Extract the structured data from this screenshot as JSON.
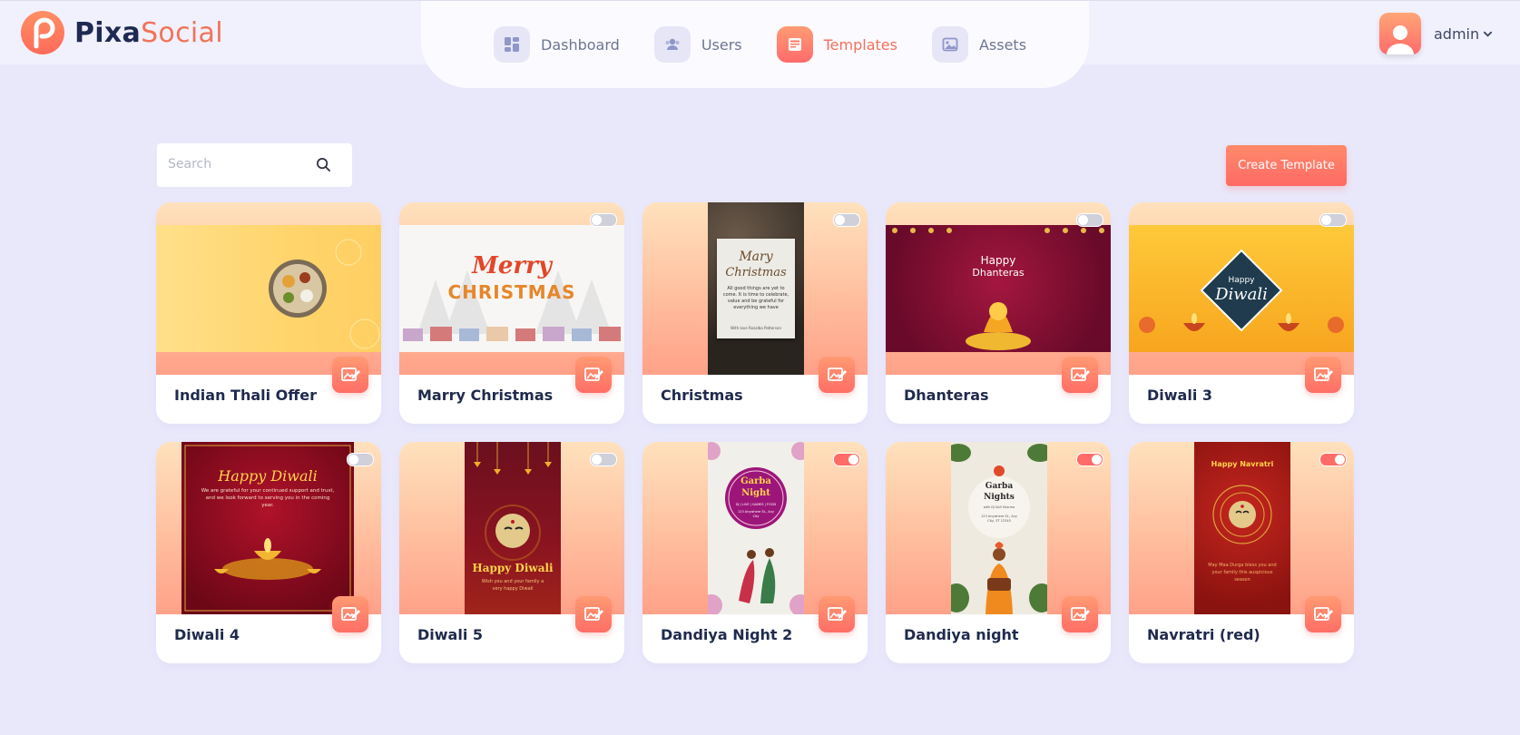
{
  "brand": {
    "part1": "Pixa",
    "part2": "Social"
  },
  "nav": [
    {
      "label": "Dashboard",
      "icon": "dashboard-icon"
    },
    {
      "label": "Users",
      "icon": "users-icon"
    },
    {
      "label": "Templates",
      "icon": "templates-icon",
      "active": true
    },
    {
      "label": "Assets",
      "icon": "assets-icon"
    }
  ],
  "user": {
    "name": "admin"
  },
  "search": {
    "placeholder": "Search"
  },
  "create_button": "Create Template",
  "colors": {
    "accent": "#ff6b6b",
    "accent_light": "#ff9b73",
    "background": "#e9e8fb",
    "title": "#1f2a4d"
  },
  "templates": [
    {
      "title": "Indian Thali Offer",
      "enabled": false,
      "art": {}
    },
    {
      "title": "Marry Christmas",
      "enabled": false,
      "art": {
        "line1": "Merry",
        "line2": "CHRISTMAS"
      }
    },
    {
      "title": "Christmas",
      "enabled": false,
      "art": {
        "line1": "Mary",
        "line2": "Christmas",
        "body": "All good things are yet to come. It is time to celebrate, value and be grateful for everything we have",
        "sign": "With love Rosalba Patterson"
      }
    },
    {
      "title": "Dhanteras",
      "enabled": false,
      "art": {
        "line1": "Happy",
        "line2": "Dhanteras"
      }
    },
    {
      "title": "Diwali 3",
      "enabled": false,
      "art": {
        "line1": "Happy",
        "line2": "Diwali"
      }
    },
    {
      "title": "Diwali 4",
      "enabled": false,
      "art": {
        "line1": "Happy Diwali",
        "body": "We are grateful for your continued support and trust, and we look forward to serving you in the coming year."
      }
    },
    {
      "title": "Diwali 5",
      "enabled": false,
      "art": {
        "line1": "Happy Diwali",
        "body": "Wish you and your family a very happy Diwali"
      }
    },
    {
      "title": "Dandiya Night 2",
      "enabled": true,
      "art": {
        "line1": "Garba",
        "line2": "Night",
        "body": "DJ | LIVE | GAMES | FOOD",
        "sub": "123 Anywhere St., Any City"
      }
    },
    {
      "title": "Dandiya night",
      "enabled": true,
      "art": {
        "line1": "Garba",
        "line2": "Nights",
        "body": "with DJ Sofi Sharma",
        "sub": "123 Anywhere St., Any City, ST 12345"
      }
    },
    {
      "title": "Navratri (red)",
      "enabled": true,
      "art": {
        "line1": "Happy Navratri",
        "body": "May Maa Durga bless you and your family this auspicious season"
      }
    }
  ]
}
